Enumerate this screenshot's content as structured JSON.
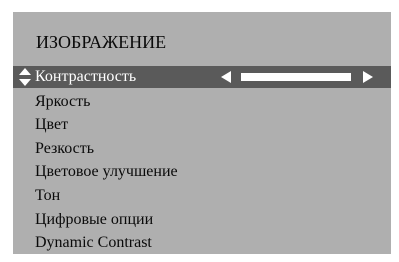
{
  "menu": {
    "title": "ИЗОБРАЖЕНИЕ",
    "selected_index": 0,
    "items": [
      {
        "label": "Контрастность"
      },
      {
        "label": "Яркость"
      },
      {
        "label": "Цвет"
      },
      {
        "label": "Резкость"
      },
      {
        "label": "Цветовое улучшение"
      },
      {
        "label": "Тон"
      },
      {
        "label": "Цифровые опции"
      },
      {
        "label": "Dynamic Contrast"
      }
    ],
    "contrast_level": 1.0
  },
  "colors": {
    "panel_bg": "#afafaf",
    "highlight_bg": "#5a5a5a",
    "text": "#0a0a0a",
    "highlight_text": "#ffffff"
  },
  "icons": {
    "selector": "up-down-arrows-icon",
    "decrease": "left-arrow-icon",
    "increase": "right-arrow-icon"
  }
}
